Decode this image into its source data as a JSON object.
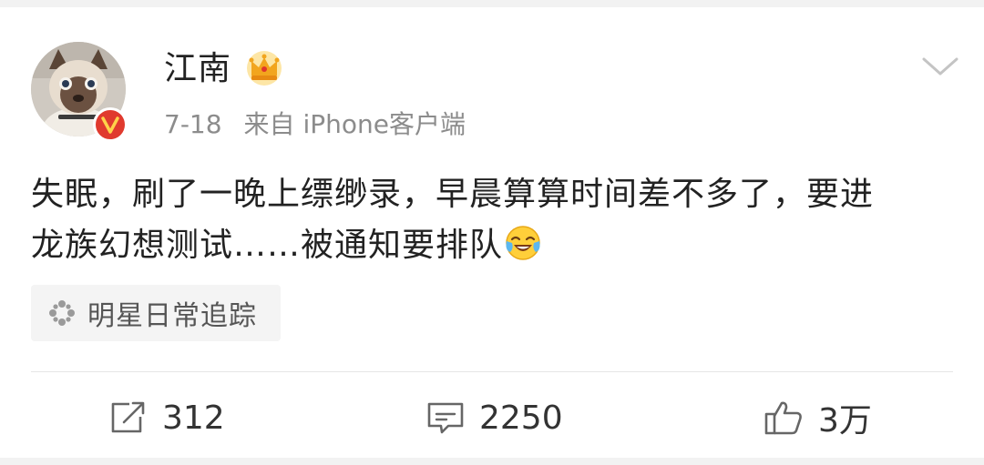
{
  "post": {
    "author": {
      "name": "江南",
      "avatar_icon": "cat-avatar",
      "verified_icon": "verified-v-icon",
      "badge_icon": "crown-icon",
      "verified_color": "#e03a2e"
    },
    "date": "7-18",
    "source": "来自 iPhone客户端",
    "menu_icon": "chevron-down-icon",
    "text_line1": "失眠，刷了一晚上缥缈录，早晨算算时间差不多了，要进",
    "text_line2": "龙族幻想测试……被通知要排队",
    "emoji_icon": "laugh-cry-emoji",
    "topic_tag": {
      "icon": "sparkle-icon",
      "label": "明星日常追踪"
    }
  },
  "actions": {
    "repost": {
      "icon": "repost-icon",
      "count": "312"
    },
    "comment": {
      "icon": "comment-icon",
      "count": "2250"
    },
    "like": {
      "icon": "thumbs-up-icon",
      "count": "3万"
    }
  }
}
